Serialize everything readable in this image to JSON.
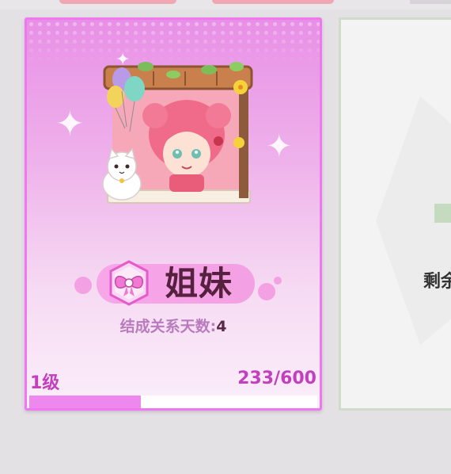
{
  "card": {
    "relation_title": "姐妹",
    "days_label": "结成关系天数:",
    "days_value": "4",
    "level_label": "1级",
    "progress_text": "233/600",
    "progress_fraction": 0.388
  },
  "right_panel": {
    "partial_text": "剩余"
  },
  "colors": {
    "card_border": "#ee78ee",
    "progress_fill": "#ee88ee",
    "title_text": "#56203f",
    "level_text": "#c23fbd"
  },
  "icons": {
    "badge": "bow-badge-icon",
    "illustration": "girl-in-window-illustration"
  }
}
